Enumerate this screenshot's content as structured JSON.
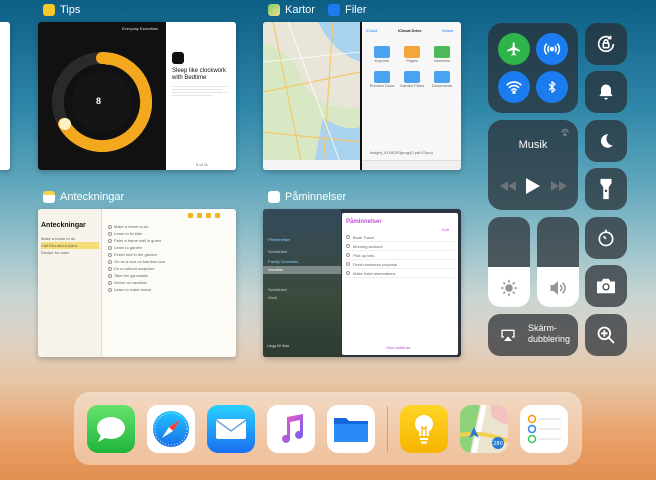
{
  "cards": {
    "tips": {
      "label": "Tips",
      "header": "Everyday Essentials",
      "clock_time": "8",
      "headline": "Sleep like clockwork with Bedtime",
      "page": "5 of 11"
    },
    "maps_files": {
      "label1": "Kartor",
      "label2": "Filer",
      "files_back": "iCloud",
      "files_title": "iCloud Drive",
      "files_select": "Select",
      "folders": [
        "Keynote",
        "Pages",
        "Numbers",
        "Preview Docs",
        "Garden Plans",
        "Documents"
      ],
      "files_footer": "Insight_0JX0DR3prog42.pdf iCloud"
    },
    "notes": {
      "label": "Anteckningar",
      "title": "Anteckningar",
      "items": [
        "Make a home to do",
        "Call Ella about plans",
        "Recipe for cake"
      ],
      "checklist": [
        "Make a home to-do",
        "Learn to fix bike",
        "Paint a frame wall in guest",
        "Learn to garden",
        "Finish bird in the garden",
        "Go on a tour on bamboo tour",
        "Do a outdoor sculpture",
        "Take the gymnastic",
        "Inform on vacation",
        "Learn to make bread"
      ]
    },
    "reminders": {
      "label": "Påminnelser",
      "list_title": "Påminnelser",
      "list_edit": "Edit",
      "sidebar": [
        "Påminnelser",
        "Scheduled",
        "Family Groceries",
        "Vacation",
        "Scheduled",
        "Work"
      ],
      "items": [
        "Book Travel",
        "Morning workout",
        "Pick up kids",
        "Finish business proposal",
        "Make hotel reservations"
      ],
      "add_list": "Lägg till lista",
      "show_completed": "Visa slutförda"
    }
  },
  "control_center": {
    "music_label": "Musik",
    "mirror_label": "Skärm-\ndubblering",
    "brightness_level": 0.45,
    "volume_level": 0.45,
    "colors": {
      "airplane": "#2fb34b",
      "active_blue": "#1b7cf0"
    }
  },
  "dock": {
    "apps": [
      "messages-icon",
      "safari-icon",
      "mail-icon",
      "music-icon",
      "files-icon",
      "tips-icon",
      "maps-icon",
      "reminders-icon"
    ]
  }
}
